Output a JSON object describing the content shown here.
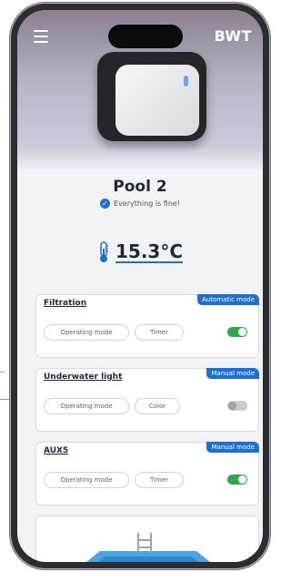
{
  "header": {
    "brand": "BWT",
    "menu_icon": "hamburger-menu-icon"
  },
  "device": {
    "name": "Pool 2",
    "status_text": "Everything is fine!",
    "status_icon": "check-circle-icon",
    "temperature": "15.3°C",
    "temperature_icon": "thermometer-icon"
  },
  "cards": [
    {
      "title": "Filtration",
      "mode": "Automatic mode",
      "buttons": [
        "Operating mode",
        "Timer"
      ],
      "toggle_on": true
    },
    {
      "title": "Underwater light",
      "mode": "Manual mode",
      "buttons": [
        "Operating mode",
        "Color"
      ],
      "toggle_on": false
    },
    {
      "title": "AUX5",
      "mode": "Manual mode",
      "buttons": [
        "Operating mode",
        "Timer"
      ],
      "toggle_on": true
    }
  ],
  "colors": {
    "accent": "#1e6fd1",
    "toggle_on": "#2ea84a",
    "toggle_off": "#c9ccd1"
  }
}
